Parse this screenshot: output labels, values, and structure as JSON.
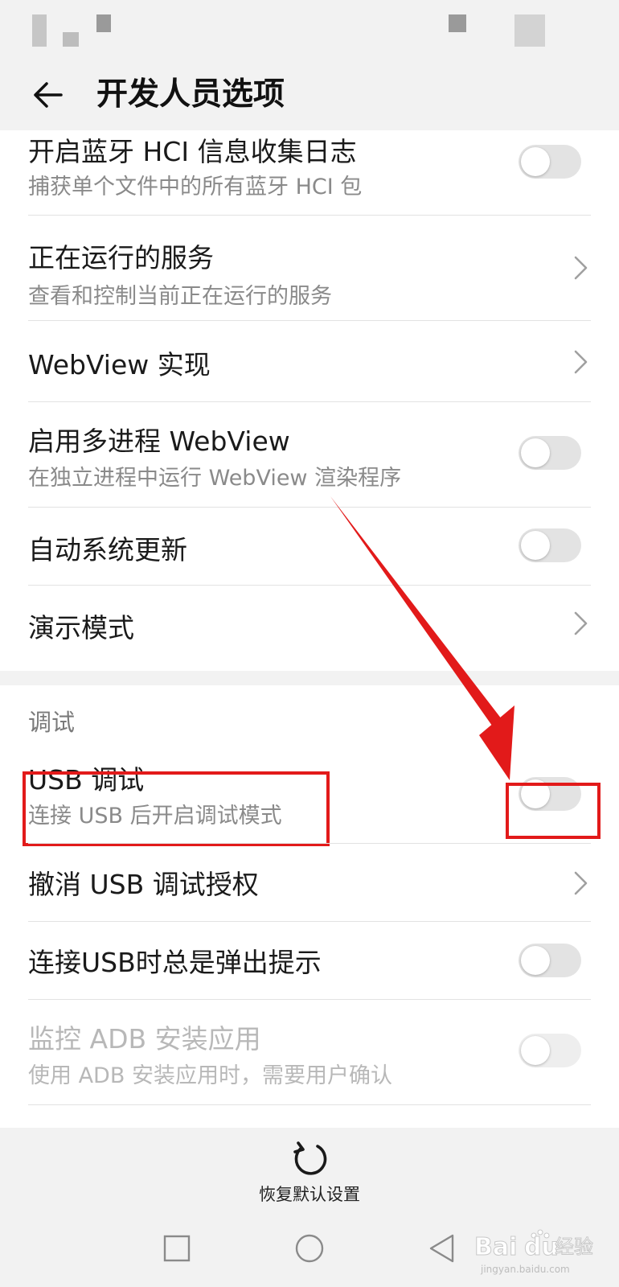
{
  "header": {
    "title": "开发人员选项"
  },
  "rows": [
    {
      "title": "开启蓝牙 HCI 信息收集日志",
      "subtitle": "捕获单个文件中的所有蓝牙 HCI 包",
      "control": "toggle",
      "checked": false
    },
    {
      "title": "正在运行的服务",
      "subtitle": "查看和控制当前正在运行的服务",
      "control": "chevron"
    },
    {
      "title": "WebView 实现",
      "control": "chevron"
    },
    {
      "title": "启用多进程 WebView",
      "subtitle": "在独立进程中运行 WebView 渲染程序",
      "control": "toggle",
      "checked": false
    },
    {
      "title": "自动系统更新",
      "control": "toggle",
      "checked": false
    },
    {
      "title": "演示模式",
      "control": "chevron"
    }
  ],
  "debug_section": {
    "header": "调试",
    "rows": [
      {
        "title": "USB 调试",
        "subtitle": "连接 USB 后开启调试模式",
        "control": "toggle",
        "checked": false
      },
      {
        "title": "撤消 USB 调试授权",
        "control": "chevron"
      },
      {
        "title": "连接USB时总是弹出提示",
        "control": "toggle",
        "checked": false
      },
      {
        "title": "监控 ADB 安装应用",
        "subtitle": "使用 ADB 安装应用时，需要用户确认",
        "control": "toggle",
        "checked": false,
        "disabled": true
      }
    ]
  },
  "footer": {
    "reset_label": "恢复默认设置"
  },
  "watermark": {
    "brand": "Bai",
    "brand2": "du",
    "suffix": "经验",
    "url": "jingyan.baidu.com"
  },
  "colors": {
    "highlight": "#e21a1a",
    "toggle_off": "#e3e3e3",
    "background_gray": "#f2f2f2"
  }
}
